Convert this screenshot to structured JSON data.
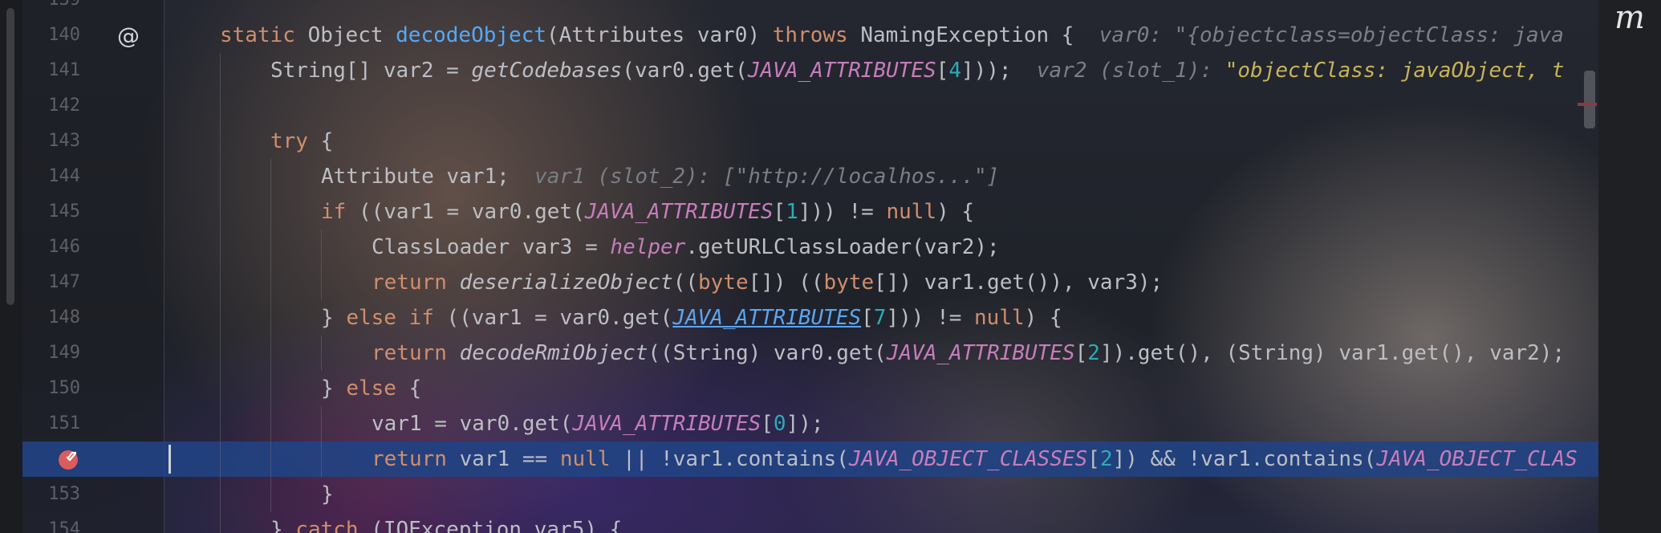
{
  "editor": {
    "plugin_logo": "m",
    "gutter_icons": {
      "override": "at-sign-icon",
      "breakpoint": "breakpoint-check-icon"
    },
    "line_numbers": {
      "top_partial": "139",
      "l140": "140",
      "l141": "141",
      "l142": "142",
      "l143": "143",
      "l144": "144",
      "l145": "145",
      "l146": "146",
      "l147": "147",
      "l148": "148",
      "l149": "149",
      "l150": "150",
      "l151": "151",
      "l153": "153",
      "bottom_partial": "154"
    },
    "code": {
      "l140": {
        "static_kw": "static",
        "object_type": "Object",
        "method_name": "decodeObject",
        "params": "(Attributes var0)",
        "throws_kw": "throws",
        "exception": "NamingException {",
        "hint": "var0: \"{objectclass=objectClass: java"
      },
      "l141": {
        "decl": "String[] var2 = ",
        "call": "getCodebases",
        "args_open": "(var0.get(",
        "const": "JAVA_ATTRIBUTES",
        "idx_open": "[",
        "idx": "4",
        "args_close": "]));",
        "hint": "var2 (slot_1):",
        "hint_value": "\"objectClass: javaObject, t"
      },
      "l143": {
        "try_kw": "try",
        "brace": " {"
      },
      "l144": {
        "decl": "Attribute var1;",
        "hint": "var1 (slot_2): [\"http://localhos...\"]"
      },
      "l145": {
        "if_kw": "if",
        "pre": " ((var1 = var0.get(",
        "const": "JAVA_ATTRIBUTES",
        "idx_open": "[",
        "idx": "1",
        "post": "])) != ",
        "null_kw": "null",
        "end": ") {"
      },
      "l146": {
        "pre": "ClassLoader var3 = ",
        "helper": "helper",
        "post": ".getURLClassLoader(var2);"
      },
      "l147": {
        "return_kw": "return",
        "call": "deserializeObject",
        "open": "((",
        "byte_kw1": "byte",
        "mid1": "[]) ((",
        "byte_kw2": "byte",
        "mid2": "[]) var1.get()), var3);"
      },
      "l148": {
        "pre": "} ",
        "else_kw": "else",
        "if_kw": "if",
        "mid": " ((var1 = var0.get(",
        "const": "JAVA_ATTRIBUTES",
        "idx_open": "[",
        "idx": "7",
        "post": "])) != ",
        "null_kw": "null",
        "end": ") {"
      },
      "l149": {
        "return_kw": "return",
        "call": "decodeRmiObject",
        "pre": "((String) var0.get(",
        "const": "JAVA_ATTRIBUTES",
        "idx_open": "[",
        "idx": "2",
        "post": "]).get(), (String) var1.get(), var2);"
      },
      "l150": {
        "pre": "} ",
        "else_kw": "else",
        "end": " {"
      },
      "l151": {
        "pre": "var1 = var0.get(",
        "const": "JAVA_ATTRIBUTES",
        "idx_open": "[",
        "idx": "0",
        "post": "]);"
      },
      "l152": {
        "return_kw": "return",
        "pre": " var1 == ",
        "null_kw": "null",
        "mid": " || !var1.contains(",
        "const1": "JAVA_OBJECT_CLASSES",
        "idx_open": "[",
        "idx": "2",
        "mid2": "]) && !var1.contains(",
        "const2": "JAVA_OBJECT_CLAS"
      },
      "l153": {
        "brace": "}"
      },
      "l154": {
        "pre": "} ",
        "catch_kw": "catch",
        "post": " (IOException var5) {"
      }
    }
  }
}
